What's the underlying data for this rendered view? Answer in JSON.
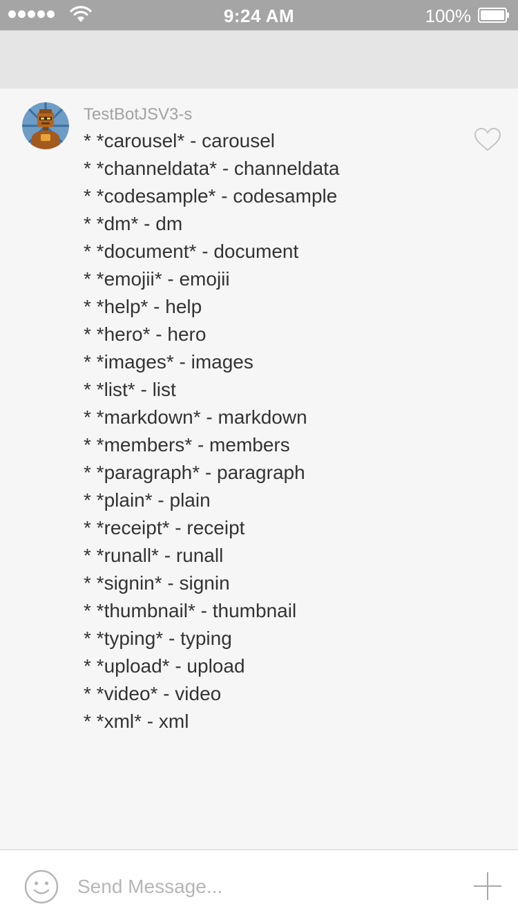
{
  "status_bar": {
    "time": "9:24 AM",
    "battery_percent": "100%",
    "signal_bars": 5,
    "icons": [
      "signal-dots-icon",
      "wifi-icon",
      "battery-icon"
    ]
  },
  "message": {
    "sender": "TestBotJSV3-s",
    "avatar_icon": "robot-avatar-icon",
    "like_icon": "heart-icon",
    "lines": [
      "* *carousel* - carousel",
      "* *channeldata* - channeldata",
      "* *codesample* - codesample",
      "* *dm* - dm",
      "* *document* - document",
      "* *emojii* - emojii",
      "* *help* - help",
      "* *hero* - hero",
      "* *images* - images",
      "* *list* - list",
      "* *markdown* - markdown",
      "* *members* - members",
      "* *paragraph* - paragraph",
      "* *plain* - plain",
      "* *receipt* - receipt",
      "* *runall* - runall",
      "* *signin* - signin",
      "* *thumbnail* - thumbnail",
      "* *typing* - typing",
      "* *upload* - upload",
      "* *video* - video",
      "* *xml* - xml"
    ]
  },
  "composer": {
    "placeholder": "Send Message...",
    "value": "",
    "emoji_icon": "smiley-icon",
    "add_icon": "plus-icon"
  },
  "colors": {
    "status_bar_bg": "#a5a5a5",
    "nav_bar_bg": "#e5e5e5",
    "chat_bg": "#f6f6f6",
    "text": "#333333",
    "sender": "#a2a2a2"
  }
}
